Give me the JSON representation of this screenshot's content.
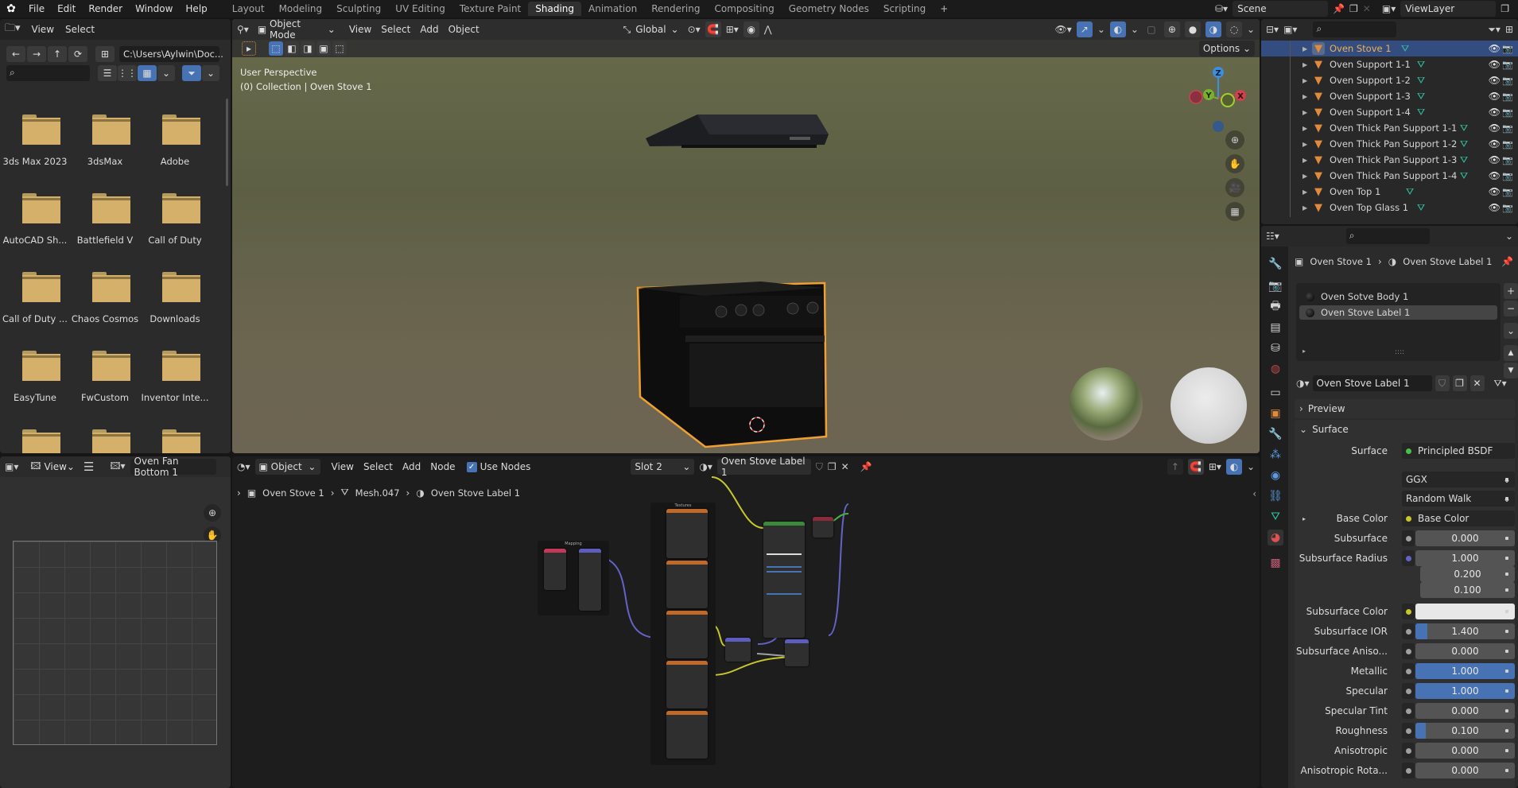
{
  "topbar": {
    "menu": [
      "File",
      "Edit",
      "Render",
      "Window",
      "Help"
    ],
    "workspaces": [
      "Layout",
      "Modeling",
      "Sculpting",
      "UV Editing",
      "Texture Paint",
      "Shading",
      "Animation",
      "Rendering",
      "Compositing",
      "Geometry Nodes",
      "Scripting"
    ],
    "active_workspace": "Shading",
    "add_workspace": "+",
    "scene": "Scene",
    "view_layer": "ViewLayer"
  },
  "file_browser": {
    "menu": [
      "View",
      "Select"
    ],
    "path": "C:\\Users\\Aylwin\\Doc...",
    "search_placeholder": "",
    "folders": [
      "3ds Max 2023",
      "3dsMax",
      "Adobe",
      "AutoCAD Sh...",
      "Battlefield V",
      "Call of Duty",
      "Call of Duty ...",
      "Chaos Cosmos",
      "Downloads",
      "EasyTune",
      "FwCustom",
      "Inventor Inte...",
      "",
      "",
      ""
    ]
  },
  "image_editor": {
    "view_label": "View",
    "image_name": "Oven Fan Bottom 1"
  },
  "viewport": {
    "mode": "Object Mode",
    "menu": [
      "View",
      "Select",
      "Add",
      "Object"
    ],
    "orientation": "Global",
    "options_label": "Options",
    "overlay_line1": "User Perspective",
    "overlay_line2": "(0) Collection | Oven Stove 1",
    "gizmo_axes": [
      "X",
      "Y",
      "Z"
    ]
  },
  "node_editor": {
    "mode": "Object",
    "menu": [
      "View",
      "Select",
      "Add",
      "Node"
    ],
    "use_nodes_label": "Use Nodes",
    "use_nodes_checked": true,
    "slot": "Slot 2",
    "material": "Oven Stove Label 1",
    "breadcrumb": [
      "Oven Stove 1",
      "Mesh.047",
      "Oven Stove Label 1"
    ],
    "frames": [
      "Mapping",
      "Textures"
    ]
  },
  "outliner": {
    "items": [
      {
        "name": "Oven Stove 1",
        "selected": true
      },
      {
        "name": "Oven Support 1-1",
        "selected": false
      },
      {
        "name": "Oven Support 1-2",
        "selected": false
      },
      {
        "name": "Oven Support 1-3",
        "selected": false
      },
      {
        "name": "Oven Support 1-4",
        "selected": false
      },
      {
        "name": "Oven Thick Pan Support 1-1",
        "selected": false
      },
      {
        "name": "Oven Thick Pan Support 1-2",
        "selected": false
      },
      {
        "name": "Oven Thick Pan Support 1-3",
        "selected": false
      },
      {
        "name": "Oven Thick Pan Support 1-4",
        "selected": false
      },
      {
        "name": "Oven Top 1",
        "selected": false
      },
      {
        "name": "Oven Top Glass 1",
        "selected": false
      }
    ]
  },
  "properties": {
    "breadcrumb_object": "Oven Stove 1",
    "breadcrumb_material": "Oven Stove Label 1",
    "material_slots": [
      "Oven Sotve Body 1",
      "Oven Stove Label 1"
    ],
    "active_slot_index": 1,
    "material_name": "Oven Stove Label 1",
    "panels": {
      "preview": "Preview",
      "surface": "Surface"
    },
    "surface_label": "Surface",
    "surface_shader": "Principled BSDF",
    "distribution": "GGX",
    "subsurface_method": "Random Walk",
    "base_color_label": "Base Color",
    "base_color_link": "Base Color",
    "rows": [
      {
        "label": "Subsurface",
        "value": "0.000",
        "fill": 0,
        "socket": "#a0a0a0"
      },
      {
        "label": "Subsurface Radius",
        "value": "1.000",
        "fill": 0,
        "socket": "#6363c7",
        "extra": [
          "0.200",
          "0.100"
        ]
      },
      {
        "label": "Subsurface Color",
        "value": "",
        "fill": 0,
        "socket": "#c7c729",
        "color": "#e8e8e8"
      },
      {
        "label": "Subsurface IOR",
        "value": "1.400",
        "fill": 0.12,
        "socket": "#a0a0a0"
      },
      {
        "label": "Subsurface Aniso...",
        "value": "0.000",
        "fill": 0,
        "socket": "#a0a0a0"
      },
      {
        "label": "Metallic",
        "value": "1.000",
        "fill": 1,
        "socket": "#a0a0a0"
      },
      {
        "label": "Specular",
        "value": "1.000",
        "fill": 1,
        "socket": "#a0a0a0"
      },
      {
        "label": "Specular Tint",
        "value": "0.000",
        "fill": 0,
        "socket": "#a0a0a0"
      },
      {
        "label": "Roughness",
        "value": "0.100",
        "fill": 0.1,
        "socket": "#a0a0a0"
      },
      {
        "label": "Anisotropic",
        "value": "0.000",
        "fill": 0,
        "socket": "#a0a0a0"
      },
      {
        "label": "Anisotropic Rota...",
        "value": "0.000",
        "fill": 0,
        "socket": "#a0a0a0"
      }
    ]
  },
  "colors": {
    "accent": "#4772b3",
    "selection_outline": "#f0a030",
    "folder": "#d4b06a",
    "object_icon": "#e08a3c",
    "mesh_icon": "#2fbf9f"
  }
}
